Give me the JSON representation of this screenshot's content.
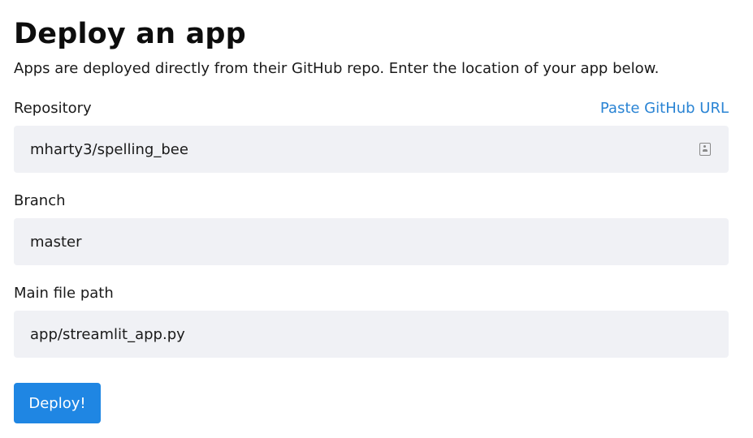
{
  "page": {
    "title": "Deploy an app",
    "subtitle": "Apps are deployed directly from their GitHub repo. Enter the location of your app below."
  },
  "repository": {
    "label": "Repository",
    "paste_link": "Paste GitHub URL",
    "value": "mharty3/spelling_bee",
    "icon": "contact-card-icon"
  },
  "branch": {
    "label": "Branch",
    "value": "master"
  },
  "main_file": {
    "label": "Main file path",
    "value": "app/streamlit_app.py"
  },
  "actions": {
    "deploy_label": "Deploy!"
  },
  "colors": {
    "accent": "#1f86e3",
    "link": "#2a84d4",
    "input_background": "#f0f1f5"
  }
}
